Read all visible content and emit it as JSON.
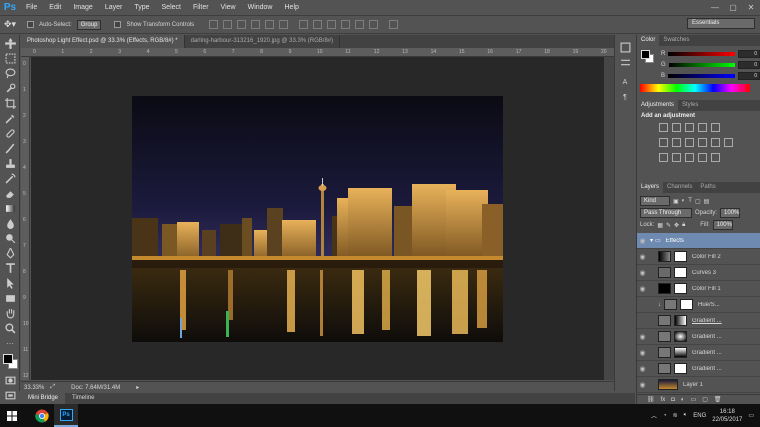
{
  "menubar": {
    "logo": "Ps",
    "items": [
      "File",
      "Edit",
      "Image",
      "Layer",
      "Type",
      "Select",
      "Filter",
      "View",
      "Window",
      "Help"
    ],
    "window_controls": [
      "—",
      "▢",
      "✕"
    ]
  },
  "options": {
    "auto_select_label": "Auto-Select:",
    "auto_select_value": "Group",
    "transform_label": "Show Transform Controls",
    "workspace": "Essentials"
  },
  "tabs": [
    {
      "label": "Photoshop Light Effect.psd @ 33.3% (Effects, RGB/8#) *",
      "active": true
    },
    {
      "label": "darling-harbour-313216_1920.jpg @ 33.3% (RGB/8#)",
      "active": false
    }
  ],
  "ruler": {
    "top": [
      "0",
      "1",
      "2",
      "3",
      "4",
      "5",
      "6",
      "7",
      "8",
      "9",
      "10",
      "11",
      "12",
      "13",
      "14",
      "15",
      "16",
      "17",
      "18",
      "19",
      "20",
      "21"
    ],
    "left": [
      "0",
      "1",
      "2",
      "3",
      "4",
      "5",
      "6",
      "7",
      "8",
      "9",
      "10",
      "11",
      "12"
    ]
  },
  "status": {
    "zoom": "33.33%",
    "doc": "Doc: 7.64M/31.4M"
  },
  "bottom_tabs": [
    "Mini Bridge",
    "Timeline"
  ],
  "color_panel": {
    "tabs": [
      "Color",
      "Swatches"
    ],
    "channels": [
      {
        "label": "R",
        "value": "0"
      },
      {
        "label": "G",
        "value": "0"
      },
      {
        "label": "B",
        "value": "0"
      }
    ]
  },
  "adjustments": {
    "tabs": [
      "Adjustments",
      "Styles"
    ],
    "heading": "Add an adjustment"
  },
  "layers": {
    "tabs": [
      "Layers",
      "Channels",
      "Paths"
    ],
    "kind": "Kind",
    "blend": "Pass Through",
    "opacity_label": "Opacity:",
    "opacity": "100%",
    "lock_label": "Lock:",
    "fill_label": "Fill:",
    "fill": "100%",
    "items": [
      {
        "name": "Effects",
        "group": true
      },
      {
        "name": "Color Fill 2",
        "thumb": "grad-dark"
      },
      {
        "name": "Curves 3",
        "thumb": "curves"
      },
      {
        "name": "Color Fill 1",
        "thumb": "black"
      },
      {
        "name": "Hue/S...",
        "thumb": "hue"
      },
      {
        "name": "Gradient ...",
        "thumb": "grad1"
      },
      {
        "name": "Gradient ...",
        "thumb": "grad2"
      },
      {
        "name": "Gradient ...",
        "thumb": "grad3"
      },
      {
        "name": "Gradient ...",
        "thumb": "grad4"
      },
      {
        "name": "Layer 1",
        "thumb": "photo"
      }
    ]
  },
  "taskbar": {
    "lang": "ENG",
    "time": "16:18",
    "date": "22/05/2017"
  },
  "colors": {
    "fg": "#000000",
    "bg": "#ffffff",
    "accent": "#31a8ff"
  }
}
